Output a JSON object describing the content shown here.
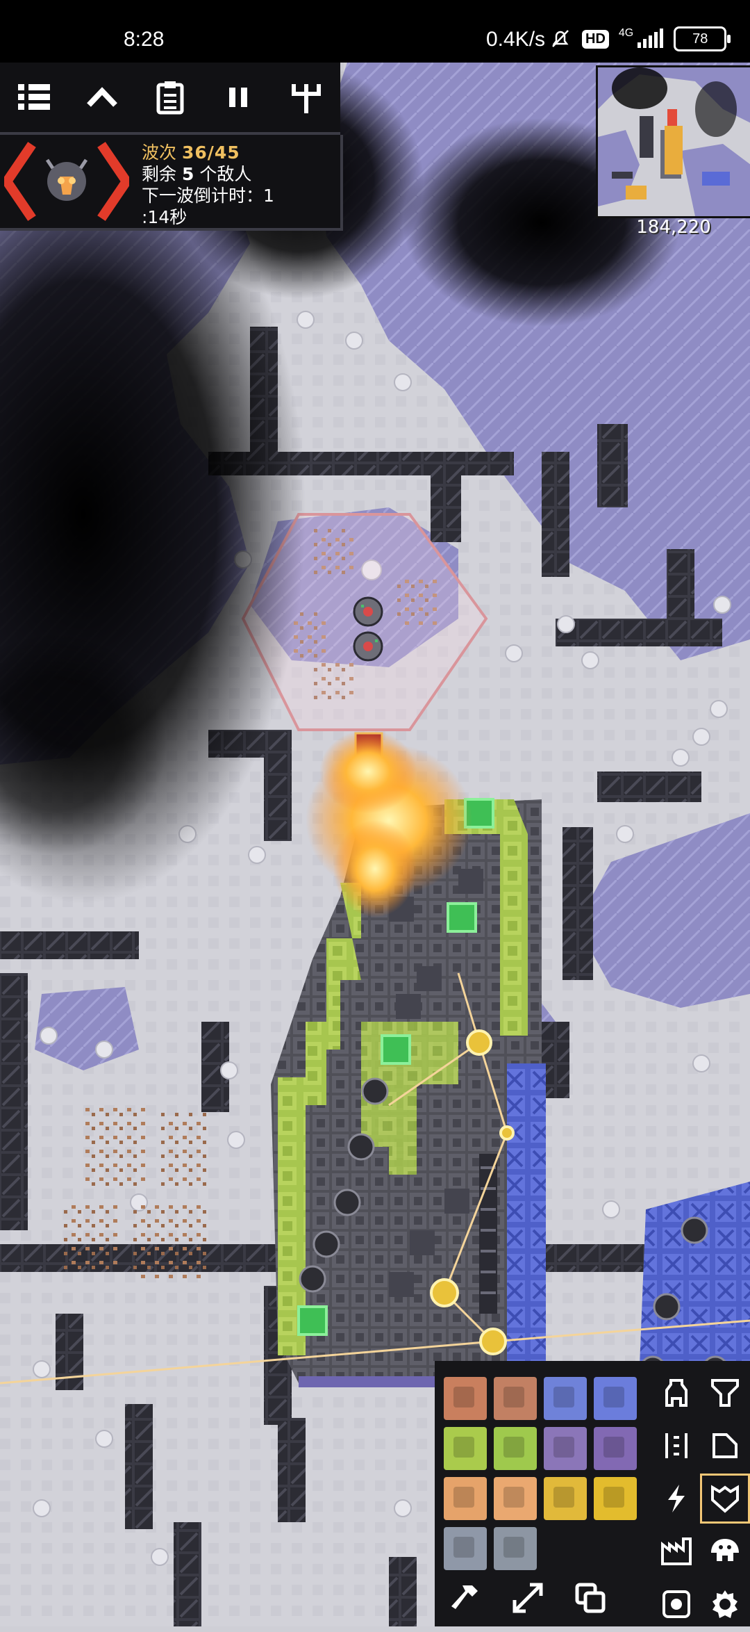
{
  "status_bar": {
    "time": "8:28",
    "net_speed": "0.4K/s",
    "hd_badge": "HD",
    "network": "4G",
    "battery": "78",
    "icons": [
      "mute-bell-icon",
      "hd-icon",
      "signal-icon",
      "battery-icon"
    ]
  },
  "toolbar": {
    "icons": [
      "menu-list-icon",
      "chevron-up-icon",
      "clipboard-icon",
      "pause-icon",
      "tech-tree-icon"
    ]
  },
  "wave": {
    "label": "波次",
    "count": "36/45",
    "enemies_prefix": "剩余",
    "enemies_count": "5",
    "enemies_suffix": "个敌人",
    "countdown_line1": "下一波倒计时：1",
    "countdown_line2": ":14秒",
    "emblem_icon": "enemy-core-icon"
  },
  "minimap": {
    "coords": "184,220"
  },
  "build_menu": {
    "blocks": [
      {
        "name": "copper-wall",
        "color": "#c97f5e"
      },
      {
        "name": "copper-wall-large",
        "color": "#c28063"
      },
      {
        "name": "titanium-wall",
        "color": "#6f82d9"
      },
      {
        "name": "titanium-wall-large",
        "color": "#6b7ddc"
      },
      {
        "name": "plastanium-wall",
        "color": "#aacb4c"
      },
      {
        "name": "plastanium-wall-large",
        "color": "#9fc94d"
      },
      {
        "name": "thorium-wall",
        "color": "#8b76b8"
      },
      {
        "name": "thorium-wall-large",
        "color": "#8269b3"
      },
      {
        "name": "phase-wall",
        "color": "#e6a36a"
      },
      {
        "name": "phase-wall-large",
        "color": "#eaa870"
      },
      {
        "name": "surge-wall",
        "color": "#e1b93a"
      },
      {
        "name": "surge-wall-large",
        "color": "#e3bc2d"
      },
      {
        "name": "door",
        "color": "#8f98a8"
      },
      {
        "name": "door-large",
        "color": "#8d96a3"
      }
    ],
    "categories": [
      {
        "icon": "turret-icon"
      },
      {
        "icon": "production-icon"
      },
      {
        "icon": "distribution-icon"
      },
      {
        "icon": "liquid-icon"
      },
      {
        "icon": "power-icon"
      },
      {
        "icon": "defense-icon",
        "active": true
      },
      {
        "icon": "crafting-icon"
      },
      {
        "icon": "units-icon"
      },
      {
        "icon": "effect-icon"
      },
      {
        "icon": "logic-icon"
      }
    ],
    "bottom_tools": [
      "hammer-icon",
      "expand-icon",
      "copy-icon"
    ]
  },
  "colors": {
    "snow": "#cfcfd6",
    "ice": "#8f8cc4",
    "dark": "#2b2b32",
    "plastanium": "#a7c64f",
    "titanium": "#5a6bd6",
    "accent_gold": "#f0c060",
    "hud_bg": "#111114"
  }
}
